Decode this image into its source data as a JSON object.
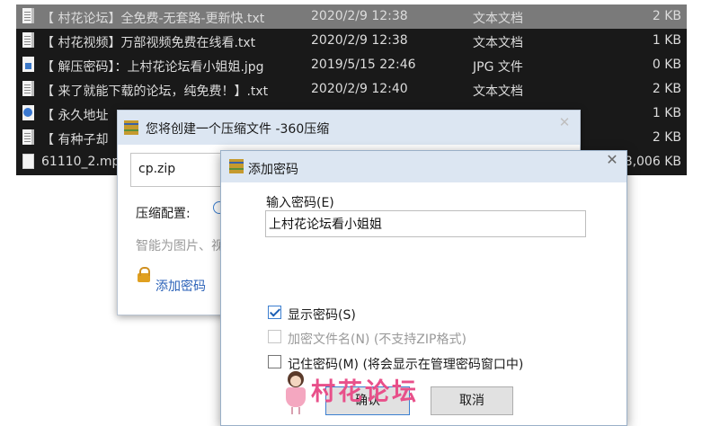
{
  "files": [
    {
      "icon": "doc",
      "name": "【 村花论坛】全免费-无套路-更新快.txt",
      "date": "2020/2/9 12:38",
      "type": "文本文档",
      "size": "2 KB",
      "selected": true
    },
    {
      "icon": "doc",
      "name": "【 村花视频】万部视频免费在线看.txt",
      "date": "2020/2/9 12:38",
      "type": "文本文档",
      "size": "1 KB",
      "selected": false
    },
    {
      "icon": "jpg",
      "name": "【 解压密码】：上村花论坛看小姐姐.jpg",
      "date": "2019/5/15 22:46",
      "type": "JPG 文件",
      "size": "0 KB",
      "selected": false
    },
    {
      "icon": "doc",
      "name": "【 来了就能下载的论坛，纯免费！】.txt",
      "date": "2020/2/9 12:40",
      "type": "文本文档",
      "size": "2 KB",
      "selected": false
    },
    {
      "icon": "url",
      "name": "【 永久地址",
      "date": "",
      "type": "",
      "size": "1 KB",
      "selected": false
    },
    {
      "icon": "doc",
      "name": "【 有种子却",
      "date": "",
      "type": "",
      "size": "2 KB",
      "selected": false
    },
    {
      "icon": "mp4",
      "name": "61110_2.mp",
      "date": "",
      "type": "",
      "size": "8,006 KB",
      "selected": false
    }
  ],
  "back_dialog": {
    "title": "您将创建一个压缩文件 -360压缩",
    "close": "✕",
    "file_name": "cp.zip",
    "config_label": "压缩配置:",
    "hint": "智能为图片、视",
    "add_password_link": "添加密码"
  },
  "password_dialog": {
    "title": "添加密码",
    "close": "✕",
    "input_label": "输入密码(E)",
    "password_value": "上村花论坛看小姐姐",
    "options": [
      {
        "label": "显示密码(S)",
        "checked": true,
        "enabled": true
      },
      {
        "label": "加密文件名(N) (不支持ZIP格式)",
        "checked": false,
        "enabled": false
      },
      {
        "label": "记住密码(M) (将会显示在管理密码窗口中)",
        "checked": false,
        "enabled": true
      }
    ],
    "ok_label": "确认",
    "cancel_label": "取消"
  },
  "watermark": {
    "text": "村花论坛"
  }
}
